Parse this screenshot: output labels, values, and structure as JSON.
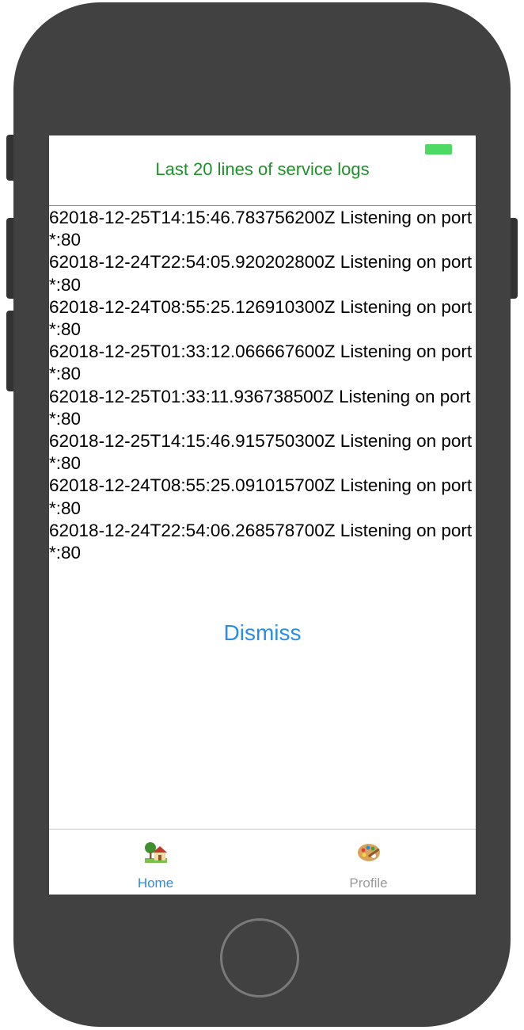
{
  "header": {
    "title": "Last 20 lines of service logs"
  },
  "status": {
    "battery_color": "#4cd964"
  },
  "logs": [
    "62018-12-25T14:15:46.783756200Z Listening on port *:80",
    "62018-12-24T22:54:05.920202800Z Listening on port *:80",
    "62018-12-24T08:55:25.126910300Z Listening on port *:80",
    "62018-12-25T01:33:12.066667600Z Listening on port *:80",
    "62018-12-25T01:33:11.936738500Z Listening on port *:80",
    "62018-12-25T14:15:46.915750300Z Listening on port *:80",
    "62018-12-24T08:55:25.091015700Z Listening on port *:80",
    "62018-12-24T22:54:06.268578700Z Listening on port *:80"
  ],
  "actions": {
    "dismiss_label": "Dismiss"
  },
  "tabbar": {
    "tabs": [
      {
        "label": "Home",
        "icon": "house-with-tree-icon",
        "active": true
      },
      {
        "label": "Profile",
        "icon": "artist-palette-icon",
        "active": false
      }
    ]
  },
  "colors": {
    "title": "#1f8f2a",
    "accent": "#2b8de6",
    "inactive_tab": "#9a9a9a"
  }
}
